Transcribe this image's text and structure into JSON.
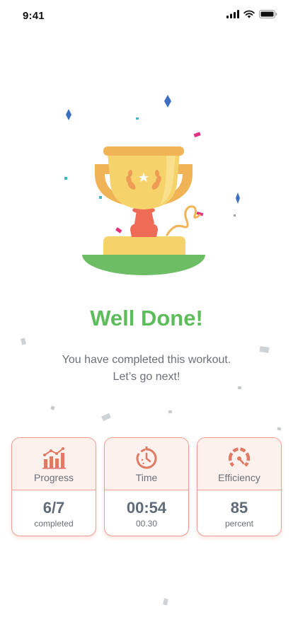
{
  "status_bar": {
    "time": "9:41"
  },
  "title": "Well Done!",
  "subtitle_line1": "You have completed this workout.",
  "subtitle_line2": "Let’s go next!",
  "colors": {
    "accent": "#5cbd5a",
    "card_border": "#ef9c8c",
    "card_header_bg": "#fdf1ee",
    "icon": "#e07a64"
  },
  "stats": [
    {
      "label": "Progress",
      "value": "6/7",
      "unit": "completed",
      "icon": "bar-chart-icon"
    },
    {
      "label": "Time",
      "value": "00:54",
      "unit": "00.30",
      "icon": "stopwatch-icon"
    },
    {
      "label": "Efficiency",
      "value": "85",
      "unit": "percent",
      "icon": "gauge-icon"
    }
  ]
}
